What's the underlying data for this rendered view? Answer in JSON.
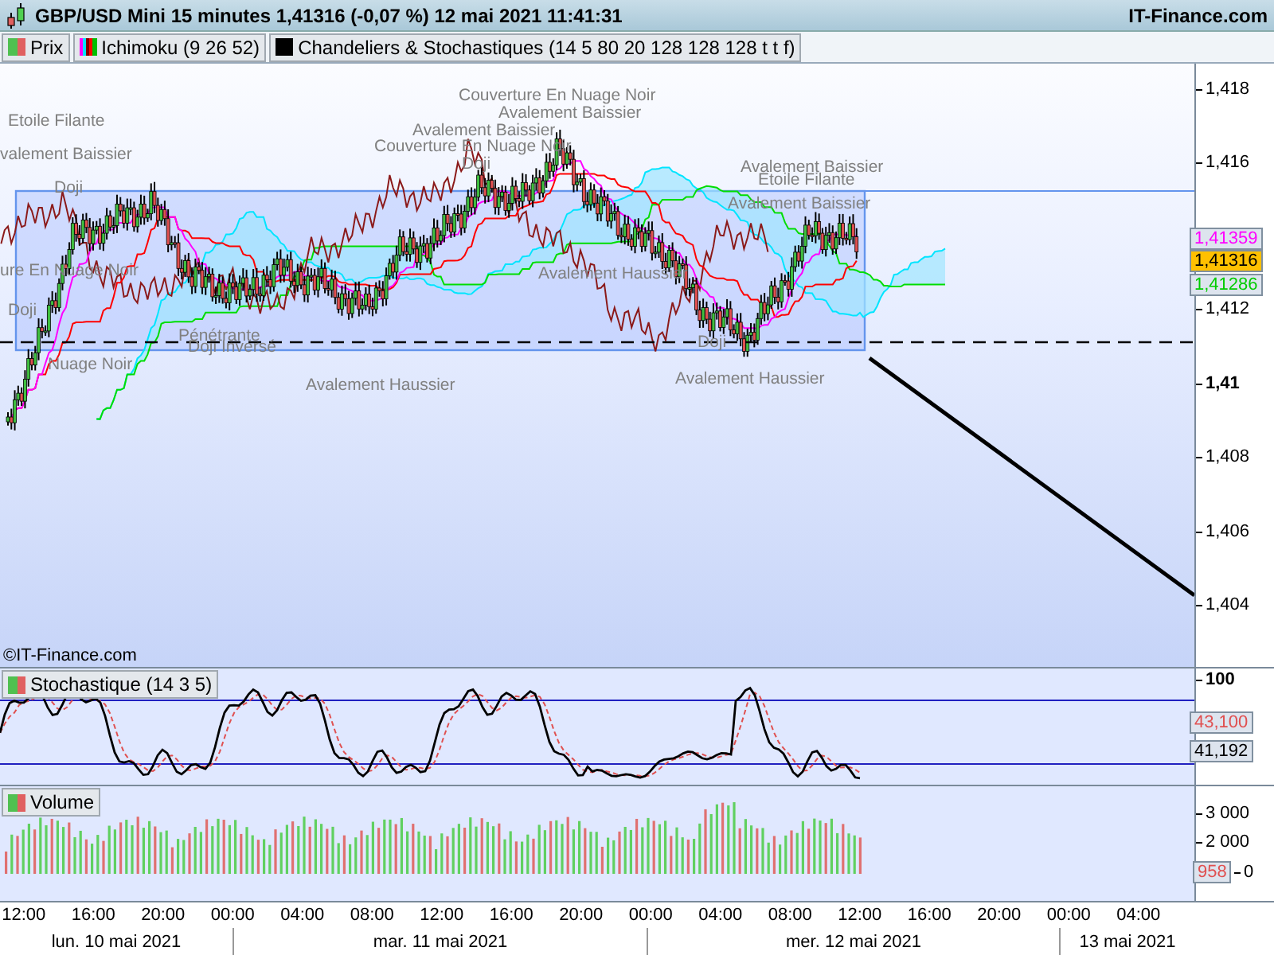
{
  "header": {
    "title": "GBP/USD Mini 15 minutes 1,41316 (-0,07 %) 12 mai 2021 11:41:31",
    "brand": "IT-Finance.com"
  },
  "legend": [
    {
      "kind": "price",
      "label": "Prix"
    },
    {
      "kind": "ichimoku",
      "label": "Ichimoku (9 26 52)"
    },
    {
      "kind": "overlay",
      "label": "Chandeliers & Stochastiques (14 5 80 20 128 128 128 t t f)"
    }
  ],
  "price_chart": {
    "pattern_labels": [
      "Couverture En Nuage Noir",
      "Avalement Baissier",
      "Etoile Filante",
      "Avalement Baissier",
      "Couverture En Nuage Noir",
      "Doji",
      "valement Baissier",
      "Doji",
      "Avalement Baissier",
      "Etoile Filante",
      "Avalement Baissier",
      "ure En Nuage Noir",
      "Doji",
      "Pénétrante",
      "Doji Inversé",
      "Nuage Noir",
      "Avalement Haussier",
      "Avalement Haussier",
      "Doji",
      "Avalement Haussier"
    ],
    "axis_ticks": [
      {
        "label": "1,418",
        "major": false
      },
      {
        "label": "1,416",
        "major": false
      },
      {
        "label": "1,412",
        "major": false
      },
      {
        "label": "1,41",
        "major": true
      },
      {
        "label": "1,408",
        "major": false
      },
      {
        "label": "1,406",
        "major": false
      },
      {
        "label": "1,404",
        "major": false
      }
    ],
    "markers": [
      {
        "value": "1,41359",
        "color": "#ff00ff"
      },
      {
        "value": "1,41286",
        "color": "#00cc00"
      }
    ],
    "current_price": "1,41316",
    "copyright": "©IT-Finance.com"
  },
  "stochastic": {
    "label": "Stochastique (14 3 5)",
    "axis_ticks": [
      "100"
    ],
    "markers": [
      {
        "value": "43,100",
        "color": "#e05050"
      },
      {
        "value": "41,192",
        "color": "#000000"
      }
    ]
  },
  "volume": {
    "label": "Volume",
    "axis_ticks": [
      "3 000",
      "2 000",
      "0"
    ],
    "marker": "958"
  },
  "time_axis": {
    "times": [
      "12:00",
      "16:00",
      "20:00",
      "00:00",
      "04:00",
      "08:00",
      "12:00",
      "16:00",
      "20:00",
      "00:00",
      "04:00",
      "08:00",
      "12:00",
      "16:00",
      "20:00",
      "00:00",
      "04:00"
    ],
    "dates": [
      "lun. 10 mai 2021",
      "mar. 11 mai 2021",
      "mer. 12 mai 2021",
      "13 mai 2021"
    ]
  }
}
